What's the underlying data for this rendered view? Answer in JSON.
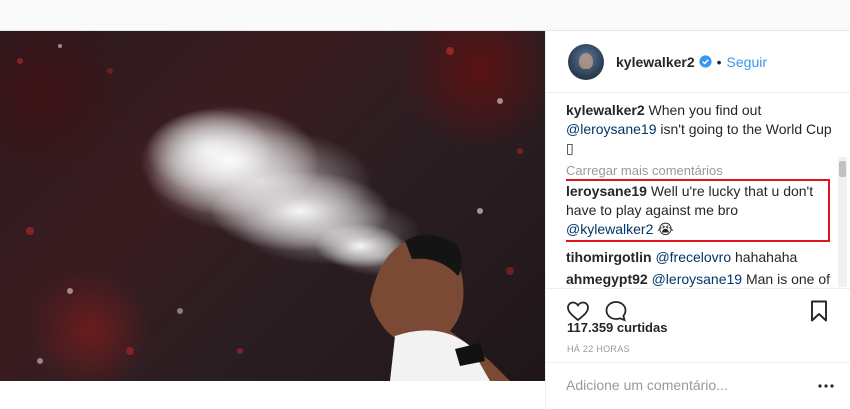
{
  "post": {
    "image_alt": "Player spitting water in stadium"
  },
  "header": {
    "username": "kylewalker2",
    "separator": "•",
    "follow_label": "Seguir"
  },
  "caption": {
    "user": "kylewalker2",
    "text_before": " When you find out ",
    "mention": "@leroysane19",
    "text_after": " isn't going to the World Cup ",
    "emoji": "▯"
  },
  "load_more_label": "Carregar mais comentários",
  "comments": [
    {
      "user": "leroysane19",
      "text_before": " Well u're lucky that u don't have to play against me bro ",
      "mention": "@kylewalker2",
      "text_after": " ",
      "emoji": "😭",
      "highlighted": true
    },
    {
      "user": "tihomirgotlin",
      "text_before": "  ",
      "mention": "@frecelovro",
      "text_after": " hahahaha",
      "emoji": ""
    },
    {
      "user": "ahmegypt92",
      "text_before": " ",
      "mention": "@leroysane19",
      "text_after": " Man is one of the best players in the EPL and doesn't go!",
      "emoji": ""
    }
  ],
  "likes_label": "117.359 curtidas",
  "time_label": "HÁ 22 HORAS",
  "add_comment": {
    "placeholder": "Adicione um comentário..."
  },
  "icons": [
    "heart-icon",
    "comment-icon",
    "bookmark-icon",
    "more-options-icon",
    "verified-badge-icon"
  ],
  "colors": {
    "link": "#3897f0",
    "mention": "#003569",
    "highlight_box": "#e0141c",
    "muted": "#999999"
  }
}
